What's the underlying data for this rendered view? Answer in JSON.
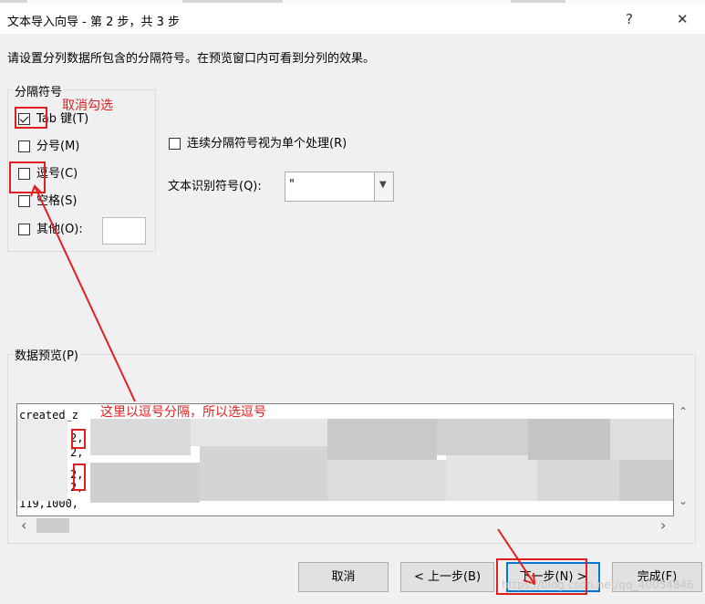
{
  "window": {
    "title": "文本导入向导 - 第 2 步，共 3 步",
    "help_label": "?",
    "close_label": "✕"
  },
  "instruction": "请设置分列数据所包含的分隔符号。在预览窗口内可看到分列的效果。",
  "delimiters": {
    "legend": "分隔符号",
    "tab": {
      "label": "Tab 键(T)",
      "checked": true
    },
    "semicolon": {
      "label": "分号(M)",
      "checked": false
    },
    "comma": {
      "label": "逗号(C)",
      "checked": false
    },
    "space": {
      "label": "空格(S)",
      "checked": false
    },
    "other": {
      "label": "其他(O):",
      "checked": false,
      "value": ""
    }
  },
  "consecutive": {
    "label": "连续分隔符号视为单个处理(R)",
    "checked": false
  },
  "qualifier": {
    "label": "文本识别符号(Q):",
    "value": "\""
  },
  "preview": {
    "legend": "数据预览(P)",
    "rows": [
      "created_z",
      "2,",
      "2,",
      "2,",
      "2,",
      "119,1000,"
    ]
  },
  "buttons": {
    "cancel": "取消",
    "back": "< 上一步(B)",
    "next": "下一步(N) >",
    "finish": "完成(F)"
  },
  "annotations": {
    "uncheck_note": "取消勾选",
    "comma_note": "这里以逗号分隔，所以选逗号",
    "color": "#e02020"
  },
  "scrollbar": {
    "up": "⌃",
    "down": "⌄",
    "left": "‹",
    "right": "›"
  },
  "watermark": "https://blog.csdn.net/qq_40054846"
}
